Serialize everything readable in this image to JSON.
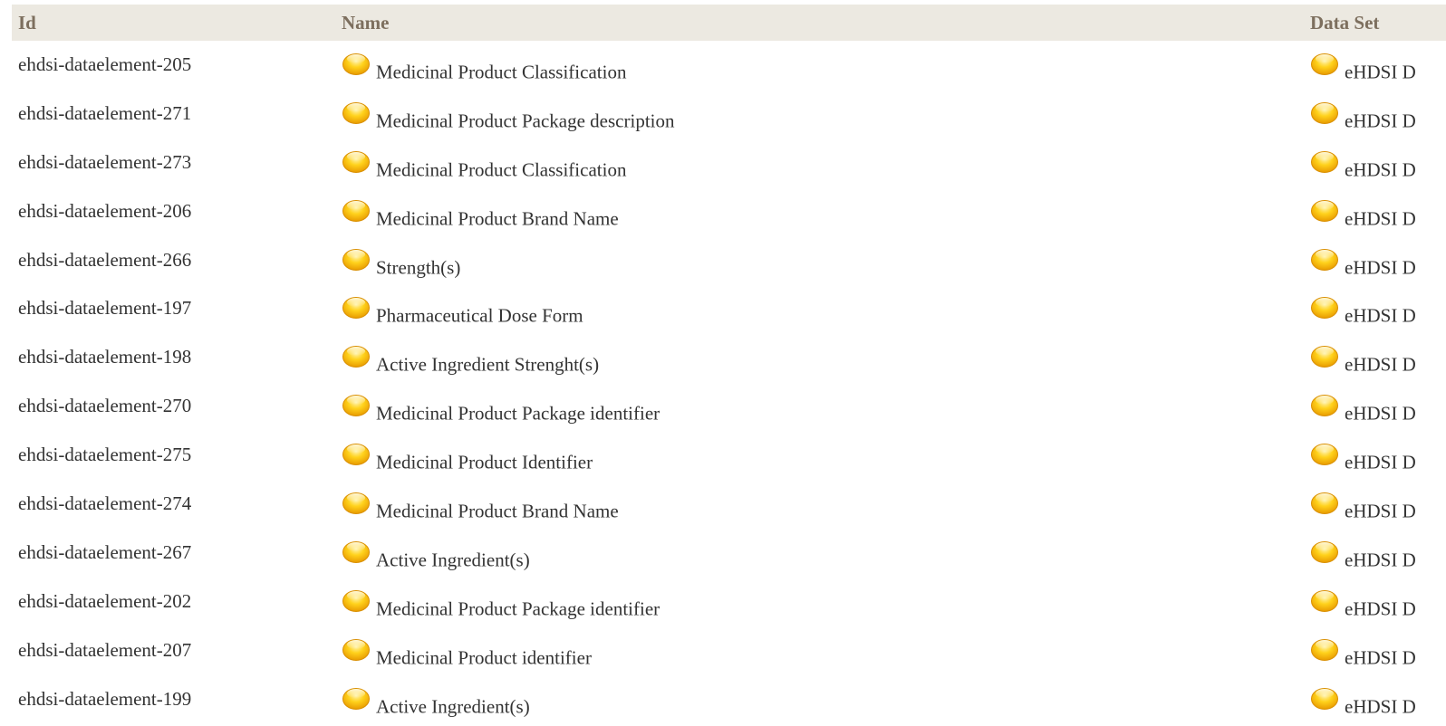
{
  "table": {
    "headers": {
      "id": "Id",
      "name": "Name",
      "dataset": "Data Set"
    },
    "rows": [
      {
        "id": "ehdsi-dataelement-205",
        "name": "Medicinal Product Classification",
        "dataset": "eHDSI D"
      },
      {
        "id": "ehdsi-dataelement-271",
        "name": "Medicinal Product Package description",
        "dataset": "eHDSI D"
      },
      {
        "id": "ehdsi-dataelement-273",
        "name": "Medicinal Product Classification",
        "dataset": "eHDSI D"
      },
      {
        "id": "ehdsi-dataelement-206",
        "name": "Medicinal Product Brand Name",
        "dataset": "eHDSI D"
      },
      {
        "id": "ehdsi-dataelement-266",
        "name": "Strength(s)",
        "dataset": "eHDSI D"
      },
      {
        "id": "ehdsi-dataelement-197",
        "name": "Pharmaceutical Dose Form",
        "dataset": "eHDSI D"
      },
      {
        "id": "ehdsi-dataelement-198",
        "name": "Active Ingredient Strenght(s)",
        "dataset": "eHDSI D"
      },
      {
        "id": "ehdsi-dataelement-270",
        "name": "Medicinal Product Package identifier",
        "dataset": "eHDSI D"
      },
      {
        "id": "ehdsi-dataelement-275",
        "name": "Medicinal Product Identifier",
        "dataset": "eHDSI D"
      },
      {
        "id": "ehdsi-dataelement-274",
        "name": "Medicinal Product Brand Name",
        "dataset": "eHDSI D"
      },
      {
        "id": "ehdsi-dataelement-267",
        "name": "Active Ingredient(s)",
        "dataset": "eHDSI D"
      },
      {
        "id": "ehdsi-dataelement-202",
        "name": "Medicinal Product Package identifier",
        "dataset": "eHDSI D"
      },
      {
        "id": "ehdsi-dataelement-207",
        "name": "Medicinal Product identifier",
        "dataset": "eHDSI D"
      },
      {
        "id": "ehdsi-dataelement-199",
        "name": "Active Ingredient(s)",
        "dataset": "eHDSI D"
      }
    ],
    "status_icon": "yellow-status-dot-icon",
    "colors": {
      "header_bg": "#ece9e1",
      "header_text": "#7d6f5e",
      "status_dot": "#f7b800"
    }
  }
}
